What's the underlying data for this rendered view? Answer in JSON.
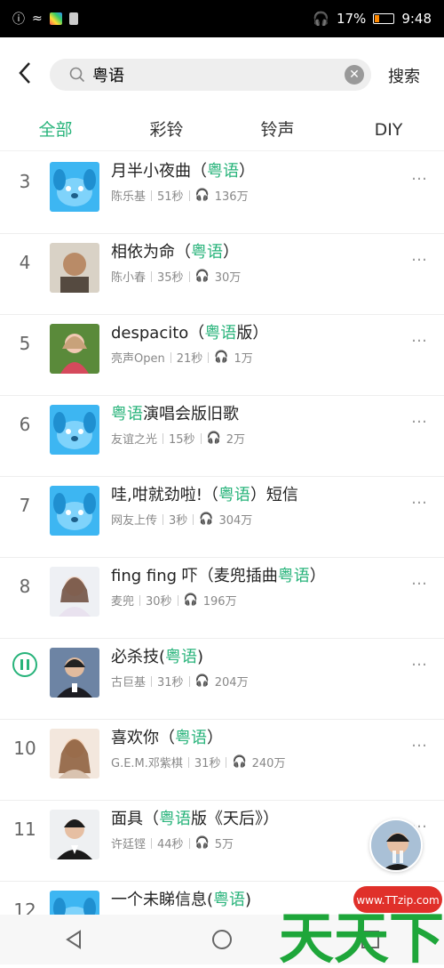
{
  "status": {
    "battery_text": "17%",
    "time": "9:48"
  },
  "search": {
    "query": "粤语",
    "button_label": "搜索"
  },
  "tabs": [
    {
      "label": "全部",
      "active": true
    },
    {
      "label": "彩铃",
      "active": false
    },
    {
      "label": "铃声",
      "active": false
    },
    {
      "label": "DIY",
      "active": false
    }
  ],
  "items": [
    {
      "num": "3",
      "title_parts": [
        "月半小夜曲（",
        "粤语",
        "）"
      ],
      "artist": "陈乐基",
      "duration": "51秒",
      "plays": "136万"
    },
    {
      "num": "4",
      "title_parts": [
        "相依为命（",
        "粤语",
        "）"
      ],
      "artist": "陈小春",
      "duration": "35秒",
      "plays": "30万"
    },
    {
      "num": "5",
      "title_parts": [
        "despacito（",
        "粤语",
        "版）"
      ],
      "artist": "亮声Open",
      "duration": "21秒",
      "plays": "1万"
    },
    {
      "num": "6",
      "title_parts": [
        "",
        "粤语",
        "演唱会版旧歌"
      ],
      "artist": "友谊之光",
      "duration": "15秒",
      "plays": "2万"
    },
    {
      "num": "7",
      "title_parts": [
        "哇,咁就劲啦!（",
        "粤语",
        "）短信"
      ],
      "artist": "网友上传",
      "duration": "3秒",
      "plays": "304万"
    },
    {
      "num": "8",
      "title_parts": [
        "fing fing 吓（麦兜插曲",
        "粤语",
        "）"
      ],
      "artist": "麦兜",
      "duration": "30秒",
      "plays": "196万"
    },
    {
      "num": "",
      "title_parts": [
        "必杀技(",
        "粤语",
        ")"
      ],
      "artist": "古巨基",
      "duration": "31秒",
      "plays": "204万"
    },
    {
      "num": "10",
      "title_parts": [
        "喜欢你（",
        "粤语",
        "）"
      ],
      "artist": "G.E.M.邓紫棋",
      "duration": "31秒",
      "plays": "240万"
    },
    {
      "num": "11",
      "title_parts": [
        "面具（",
        "粤语",
        "版《天后》）"
      ],
      "artist": "许廷铿",
      "duration": "44秒",
      "plays": "5万"
    },
    {
      "num": "12",
      "title_parts": [
        "一个未睇信息(",
        "粤语",
        ")"
      ],
      "artist": "",
      "duration": "",
      "plays": ""
    }
  ],
  "watermark": {
    "site": "www.TTzip.com",
    "brand": "天天下载"
  },
  "colors": {
    "accent": "#27b37a",
    "dog_bg": "#3db6f2"
  }
}
